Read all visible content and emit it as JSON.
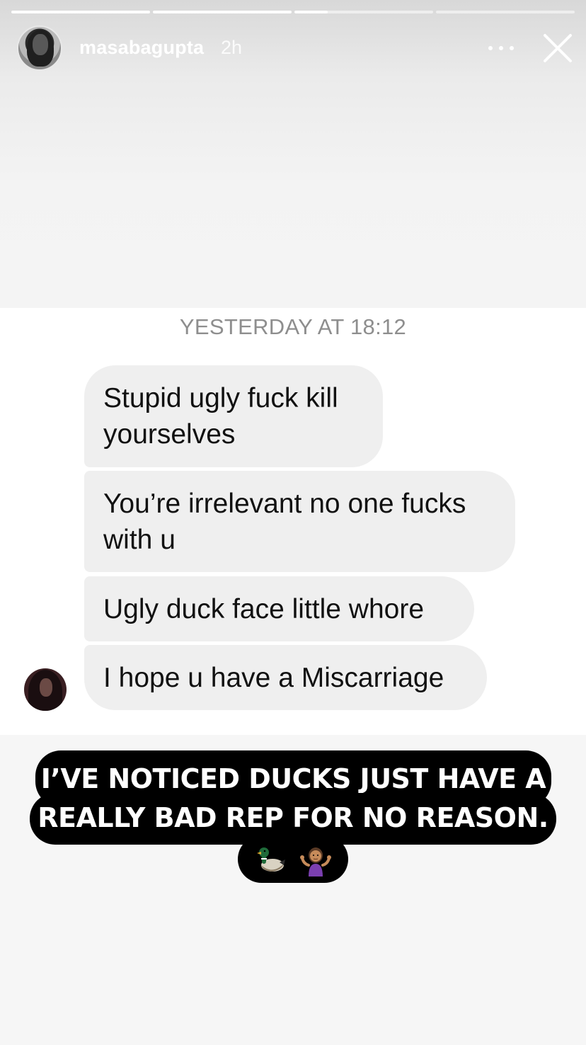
{
  "story": {
    "username": "masabagupta",
    "time_ago": "2h",
    "progress": [
      1.0,
      1.0,
      0.24,
      0.0
    ],
    "avatar_icon": "profile-photo",
    "more_icon": "more-horizontal-icon",
    "close_icon": "close-icon"
  },
  "chat": {
    "date_label": "YESTERDAY AT 18:12",
    "messages": [
      {
        "line1": "Stupid ugly fuck kill",
        "line2": "yourselves"
      },
      {
        "line1": "You’re irrelevant no one fucks",
        "line2": "with u"
      },
      {
        "line1": "Ugly duck face  little whore"
      },
      {
        "line1": "I hope u have a  Miscarriage"
      }
    ],
    "bubble_color": "#efefef"
  },
  "caption": {
    "line1": "I’VE NOTICED DUCKS JUST HAVE A",
    "line2": "REALLY BAD REP FOR NO REASON.",
    "emojis": [
      "duck-icon",
      "person-shrugging-icon"
    ]
  }
}
